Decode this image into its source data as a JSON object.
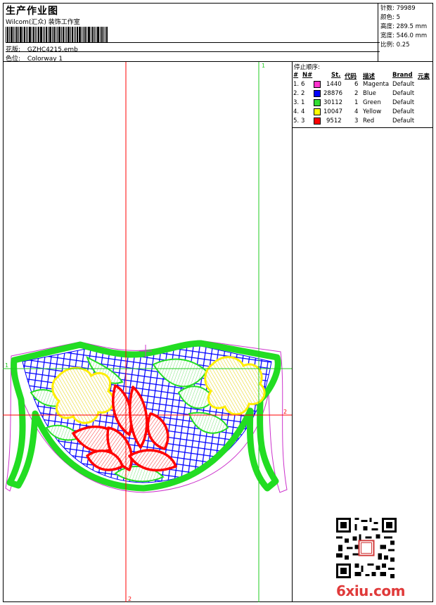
{
  "header": {
    "title": "生产作业图",
    "subtitle": "Wilcom(汇众) 装饰工作室",
    "design_label": "花版:",
    "design_value": "GZHC4215.emb",
    "colorway_label": "色位:",
    "colorway_value": "Colorway 1"
  },
  "stats": [
    {
      "label": "针数:",
      "value": "79989"
    },
    {
      "label": "颜色:",
      "value": "5"
    },
    {
      "label": "高度:",
      "value": "289.5 mm"
    },
    {
      "label": "宽度:",
      "value": "546.0 mm"
    },
    {
      "label": "比例:",
      "value": "0.25"
    }
  ],
  "thread_panel": {
    "title": "停止顺序:",
    "columns": [
      "#",
      "N#",
      "St.",
      "代码",
      "描述",
      "Brand",
      "元素"
    ],
    "rows": [
      {
        "order": "1.",
        "n": "6",
        "stitches": "1440",
        "code": "6",
        "desc": "Magenta",
        "brand": "Default",
        "color": "#ff33cc"
      },
      {
        "order": "2.",
        "n": "2",
        "stitches": "28876",
        "code": "2",
        "desc": "Blue",
        "brand": "Default",
        "color": "#0000ff"
      },
      {
        "order": "3.",
        "n": "1",
        "stitches": "30112",
        "code": "1",
        "desc": "Green",
        "brand": "Default",
        "color": "#33dd33"
      },
      {
        "order": "4.",
        "n": "4",
        "stitches": "10047",
        "code": "4",
        "desc": "Yellow",
        "brand": "Default",
        "color": "#ffff00"
      },
      {
        "order": "5.",
        "n": "3",
        "stitches": "9512",
        "code": "3",
        "desc": "Red",
        "brand": "Default",
        "color": "#ff0000"
      }
    ]
  },
  "canvas": {
    "guide_labels": {
      "green_top": "1",
      "green_left": "1",
      "red_bottom": "2",
      "red_right": "2"
    }
  },
  "watermark": {
    "text": "6xiu.com",
    "stamp_text": "汇众"
  }
}
